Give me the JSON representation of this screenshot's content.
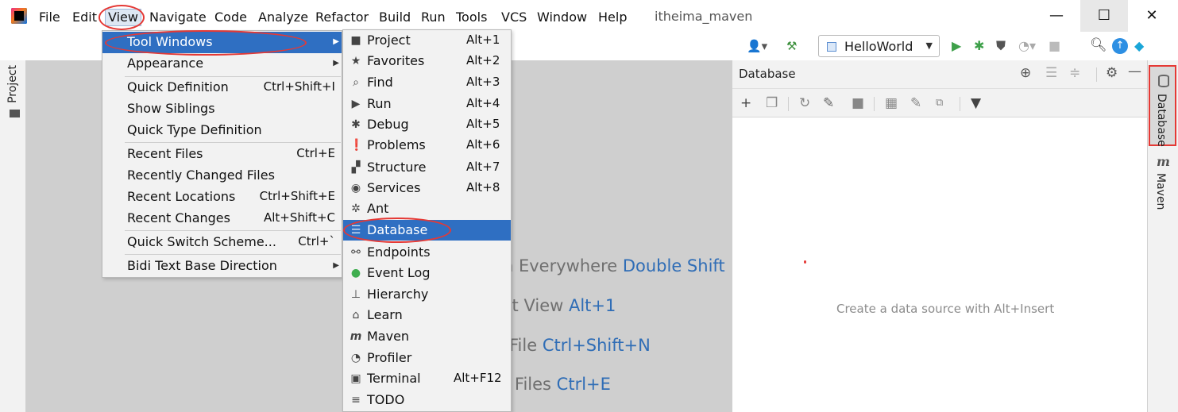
{
  "app": {
    "title": "itheima_maven"
  },
  "menubar": {
    "items": [
      "File",
      "Edit",
      "View",
      "Navigate",
      "Code",
      "Analyze",
      "Refactor",
      "Build",
      "Run",
      "Tools",
      "VCS",
      "Window",
      "Help"
    ],
    "active": "View"
  },
  "window_controls": {
    "minimize": "—",
    "maximize": "☐",
    "close": "✕"
  },
  "toolbar": {
    "run_config": "HelloWorld"
  },
  "left_stripe": {
    "project_label": "Project"
  },
  "view_menu": {
    "items": [
      {
        "label": "Tool Windows",
        "shortcut": "",
        "submenu": true,
        "selected": true
      },
      {
        "label": "Appearance",
        "shortcut": "",
        "submenu": true
      },
      {
        "label": "Quick Definition",
        "shortcut": "Ctrl+Shift+I"
      },
      {
        "label": "Show Siblings",
        "shortcut": ""
      },
      {
        "label": "Quick Type Definition",
        "shortcut": ""
      },
      {
        "label": "Recent Files",
        "shortcut": "Ctrl+E"
      },
      {
        "label": "Recently Changed Files",
        "shortcut": ""
      },
      {
        "label": "Recent Locations",
        "shortcut": "Ctrl+Shift+E"
      },
      {
        "label": "Recent Changes",
        "shortcut": "Alt+Shift+C"
      },
      {
        "label": "Quick Switch Scheme...",
        "shortcut": "Ctrl+`"
      },
      {
        "label": "Bidi Text Base Direction",
        "shortcut": "",
        "submenu": true
      }
    ]
  },
  "tool_windows_menu": {
    "items": [
      {
        "label": "Project",
        "shortcut": "Alt+1",
        "icon": "folder-icon"
      },
      {
        "label": "Favorites",
        "shortcut": "Alt+2",
        "icon": "star-icon"
      },
      {
        "label": "Find",
        "shortcut": "Alt+3",
        "icon": "search-icon"
      },
      {
        "label": "Run",
        "shortcut": "Alt+4",
        "icon": "play-icon"
      },
      {
        "label": "Debug",
        "shortcut": "Alt+5",
        "icon": "bug-icon"
      },
      {
        "label": "Problems",
        "shortcut": "Alt+6",
        "icon": "warning-icon"
      },
      {
        "label": "Structure",
        "shortcut": "Alt+7",
        "icon": "structure-icon"
      },
      {
        "label": "Services",
        "shortcut": "Alt+8",
        "icon": "services-icon"
      },
      {
        "label": "Ant",
        "shortcut": "",
        "icon": "ant-icon"
      },
      {
        "label": "Database",
        "shortcut": "",
        "icon": "database-icon",
        "selected": true
      },
      {
        "label": "Endpoints",
        "shortcut": "",
        "icon": "endpoints-icon"
      },
      {
        "label": "Event Log",
        "shortcut": "",
        "icon": "event-log-icon"
      },
      {
        "label": "Hierarchy",
        "shortcut": "",
        "icon": "hierarchy-icon"
      },
      {
        "label": "Learn",
        "shortcut": "",
        "icon": "learn-icon"
      },
      {
        "label": "Maven",
        "shortcut": "",
        "icon": "maven-icon"
      },
      {
        "label": "Profiler",
        "shortcut": "",
        "icon": "profiler-icon"
      },
      {
        "label": "Terminal",
        "shortcut": "Alt+F12",
        "icon": "terminal-icon"
      },
      {
        "label": "TODO",
        "shortcut": "",
        "icon": "todo-icon"
      }
    ]
  },
  "editor_hints": [
    {
      "text": "n Everywhere ",
      "key": "Double Shift"
    },
    {
      "text": "ct View ",
      "key": "Alt+1"
    },
    {
      "text": " File ",
      "key": "Ctrl+Shift+N"
    },
    {
      "text": "t Files ",
      "key": "Ctrl+E"
    }
  ],
  "database_panel": {
    "title": "Database",
    "empty_text": "Create a data source with Alt+Insert"
  },
  "right_stripe": {
    "database_label": "Database",
    "maven_label": "Maven",
    "maven_glyph": "m"
  },
  "colors": {
    "selection": "#2f6fc2",
    "annotation": "#e53935",
    "shortcut_key": "#2f6db6"
  }
}
